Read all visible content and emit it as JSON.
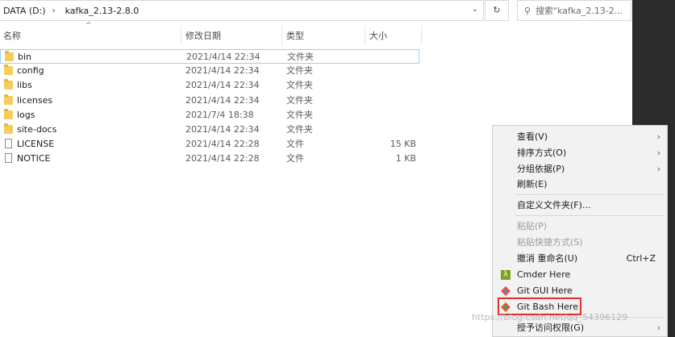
{
  "address": {
    "drive": "DATA (D:)",
    "folder": "kafka_2.13-2.8.0"
  },
  "search": {
    "placeholder": "搜索\"kafka_2.13-2..."
  },
  "columns": {
    "name": "名称",
    "date": "修改日期",
    "type": "类型",
    "size": "大小"
  },
  "files": [
    {
      "name": "bin",
      "date": "2021/4/14 22:34",
      "type": "文件夹",
      "size": "",
      "kind": "folder",
      "selected": true
    },
    {
      "name": "config",
      "date": "2021/4/14 22:34",
      "type": "文件夹",
      "size": "",
      "kind": "folder"
    },
    {
      "name": "libs",
      "date": "2021/4/14 22:34",
      "type": "文件夹",
      "size": "",
      "kind": "folder"
    },
    {
      "name": "licenses",
      "date": "2021/4/14 22:34",
      "type": "文件夹",
      "size": "",
      "kind": "folder"
    },
    {
      "name": "logs",
      "date": "2021/7/4 18:38",
      "type": "文件夹",
      "size": "",
      "kind": "folder"
    },
    {
      "name": "site-docs",
      "date": "2021/4/14 22:34",
      "type": "文件夹",
      "size": "",
      "kind": "folder"
    },
    {
      "name": "LICENSE",
      "date": "2021/4/14 22:28",
      "type": "文件",
      "size": "15 KB",
      "kind": "file"
    },
    {
      "name": "NOTICE",
      "date": "2021/4/14 22:28",
      "type": "文件",
      "size": "1 KB",
      "kind": "file"
    }
  ],
  "context_menu": {
    "view": "查看(V)",
    "sort": "排序方式(O)",
    "group": "分组依据(P)",
    "refresh": "刷新(E)",
    "customize": "自定义文件夹(F)...",
    "paste": "粘贴(P)",
    "paste_shortcut": "粘贴快捷方式(S)",
    "undo_rename": "撤消 重命名(U)",
    "undo_shortcut": "Ctrl+Z",
    "cmder": "Cmder Here",
    "git_gui": "Git GUI Here",
    "git_bash": "Git Bash Here",
    "access": "授予访问权限(G)"
  },
  "icons": {
    "cmder": "λ"
  },
  "watermark": "https://blog.csdn.net/qq_54396129",
  "colors": {
    "highlight": "#e0302b",
    "folder": "#f4cd5c",
    "selection": "#9ccff5"
  }
}
